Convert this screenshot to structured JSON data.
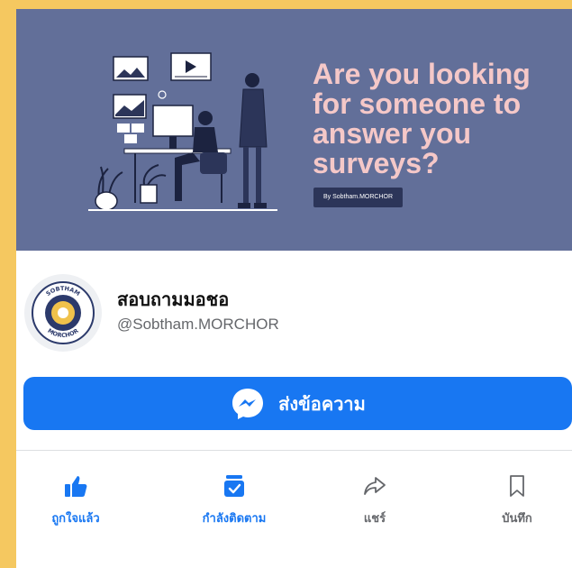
{
  "cover": {
    "headline": "Are you looking\nfor someone to\nanswer you\nsurveys?",
    "byline": "By Sobtham.MORCHOR",
    "colors": {
      "background": "#626f99",
      "headline": "#f5c8c8",
      "byline_bg": "#2c3559"
    }
  },
  "profile": {
    "name": "สอบถามมอชอ",
    "handle": "@Sobtham.MORCHOR",
    "logo": {
      "top_text": "SOBTHAM",
      "bottom_text": "MORCHOR"
    }
  },
  "message_button": {
    "label": "ส่งข้อความ",
    "icon": "messenger-icon",
    "color": "#1877f2"
  },
  "actions": [
    {
      "label": "ถูกใจแล้ว",
      "icon": "thumbs-up-icon",
      "active": true
    },
    {
      "label": "กำลังติดตาม",
      "icon": "following-inbox-icon",
      "active": true
    },
    {
      "label": "แชร์",
      "icon": "share-arrow-icon",
      "active": false
    },
    {
      "label": "บันทึก",
      "icon": "bookmark-icon",
      "active": false
    }
  ],
  "colors": {
    "frame": "#f5c860",
    "accent": "#1877f2",
    "muted": "#65676b"
  }
}
